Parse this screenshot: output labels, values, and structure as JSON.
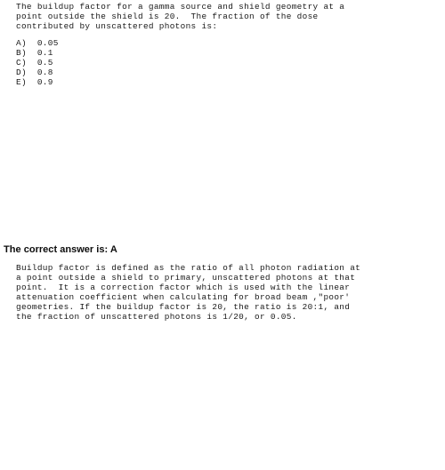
{
  "document": {
    "background_color": "#ffffff",
    "text_color": "#181818",
    "heading_color": "#0d0d0d"
  },
  "question": {
    "stem_lines": [
      "The buildup factor for a gamma source and shield geometry at a",
      "point outside the shield is 20.  The fraction of the dose",
      "contributed by unscattered photons is:"
    ],
    "options": [
      "A)  0.05",
      "B)  0.1",
      "C)  0.5",
      "D)  0.8",
      "E)  0.9"
    ]
  },
  "answer": {
    "heading": "The correct answer is: A",
    "explanation_lines": [
      "Buildup factor is defined as the ratio of all photon radiation at",
      "a point outside a shield to primary, unscattered photons at that",
      "point.  It is a correction factor which is used with the linear",
      "attenuation coefficient when calculating for broad beam ,\"poor'",
      "geometries. If the buildup factor is 20, the ratio is 20:1, and",
      "the fraction of unscattered photons is 1/20, or 0.05."
    ]
  }
}
